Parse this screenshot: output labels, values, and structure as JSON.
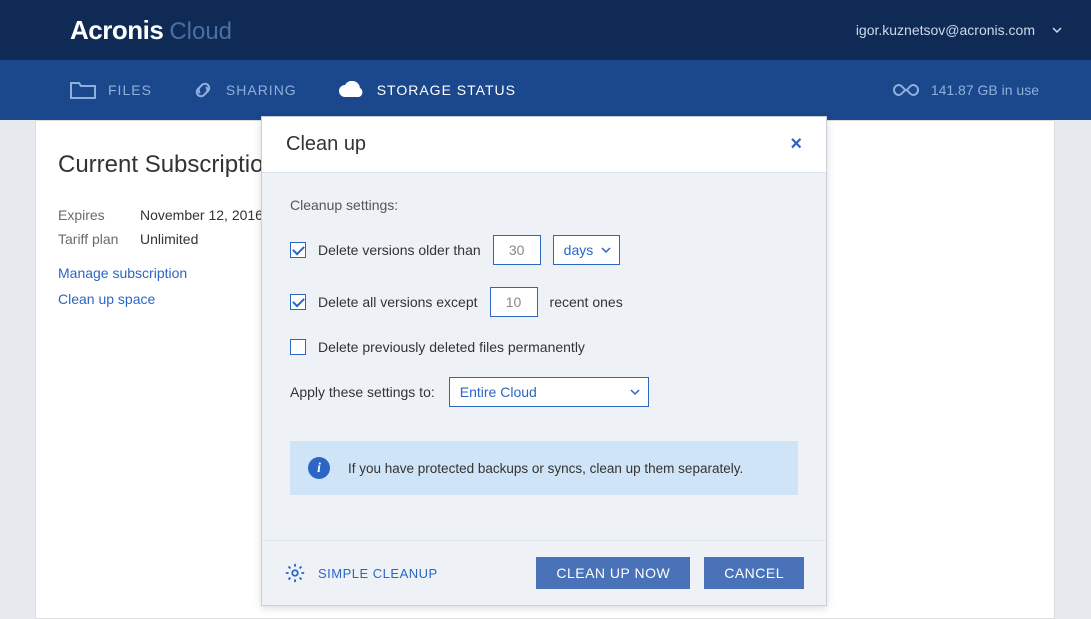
{
  "brand": {
    "main": "Acronis",
    "sub": "Cloud"
  },
  "user": {
    "email": "igor.kuznetsov@acronis.com"
  },
  "nav": {
    "files": "FILES",
    "sharing": "SHARING",
    "storage": "STORAGE STATUS",
    "usage": "141.87 GB in use"
  },
  "page": {
    "title": "Current Subscription",
    "expires_label": "Expires",
    "expires_value": "November 12, 2016",
    "tariff_label": "Tariff plan",
    "tariff_value": "Unlimited",
    "link_manage": "Manage subscription",
    "link_cleanup": "Clean up space"
  },
  "modal": {
    "title": "Clean up",
    "settings_label": "Cleanup settings:",
    "opt1_label": "Delete versions older than",
    "opt1_value": "30",
    "opt1_unit": "days",
    "opt2_label": "Delete all versions except",
    "opt2_value": "10",
    "opt2_suffix": "recent ones",
    "opt3_label": "Delete previously deleted files permanently",
    "apply_label": "Apply these settings to:",
    "apply_value": "Entire Cloud",
    "info_text": "If you have protected backups or syncs, clean up them separately.",
    "simple_cleanup": "SIMPLE CLEANUP",
    "btn_cleanup": "CLEAN UP NOW",
    "btn_cancel": "CANCEL"
  }
}
